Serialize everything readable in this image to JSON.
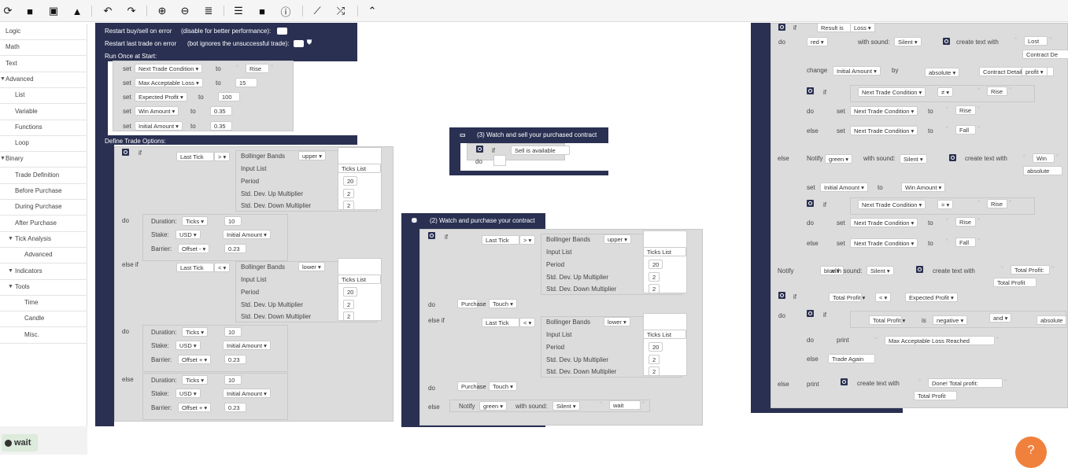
{
  "toolbar": {
    "icons": [
      "refresh-icon",
      "folder-icon",
      "save-icon",
      "drive-icon",
      "undo-icon",
      "redo-icon",
      "zoom-in-icon",
      "zoom-out-icon",
      "sort-icon",
      "list-icon",
      "stop-icon",
      "info-icon",
      "chart-icon",
      "shuffle-icon",
      "collapse-icon"
    ],
    "glyphs": [
      "⟳",
      "■",
      "▣",
      "▲",
      "↶",
      "↷",
      "⊕",
      "⊖",
      "≣",
      "☰",
      "■",
      "ⓘ",
      "⟋",
      "⤮",
      "⌃"
    ]
  },
  "sidebar": {
    "items": [
      {
        "label": "Logic",
        "depth": 0,
        "arrow": false
      },
      {
        "label": "Math",
        "depth": 0,
        "arrow": false
      },
      {
        "label": "Text",
        "depth": 0,
        "arrow": false
      },
      {
        "label": "Advanced",
        "depth": 0,
        "arrow": true
      },
      {
        "label": "List",
        "depth": 1,
        "arrow": false
      },
      {
        "label": "Variable",
        "depth": 1,
        "arrow": false
      },
      {
        "label": "Functions",
        "depth": 1,
        "arrow": false
      },
      {
        "label": "Loop",
        "depth": 1,
        "arrow": false
      },
      {
        "label": "Binary",
        "depth": 0,
        "arrow": true
      },
      {
        "label": "Trade Definition",
        "depth": 1,
        "arrow": false
      },
      {
        "label": "Before Purchase",
        "depth": 1,
        "arrow": false
      },
      {
        "label": "During Purchase",
        "depth": 1,
        "arrow": false
      },
      {
        "label": "After Purchase",
        "depth": 1,
        "arrow": false
      },
      {
        "label": "Tick Analysis",
        "depth": 1,
        "arrow": true
      },
      {
        "label": "Advanced",
        "depth": 2,
        "arrow": false
      },
      {
        "label": "Indicators",
        "depth": 1,
        "arrow": true
      },
      {
        "label": "Tools",
        "depth": 1,
        "arrow": true
      },
      {
        "label": "Time",
        "depth": 2,
        "arrow": false
      },
      {
        "label": "Candle",
        "depth": 2,
        "arrow": false
      },
      {
        "label": "Misc.",
        "depth": 2,
        "arrow": false
      }
    ]
  },
  "wait_button": "wait",
  "help_glyph": "?",
  "labels": {
    "set": "set",
    "to": "to",
    "if": "if",
    "do": "do",
    "else": "else",
    "else_if": "else if",
    "duration": "Duration:",
    "stake": "Stake:",
    "barrier": "Barrier:",
    "bollinger": "Bollinger Bands",
    "input_list": "Input List",
    "period": "Period",
    "std_up": "Std. Dev. Up Multiplier",
    "std_down": "Std. Dev. Down Multiplier",
    "ticks_list": "Ticks List",
    "last_tick": "Last Tick",
    "purchase": "Purchase",
    "touch": "Touch ▾",
    "notify": "Notify",
    "with_sound": "with sound:",
    "silent": "Silent ▾",
    "create_text": "create text with",
    "upper": "upper ▾",
    "lower": "lower ▾",
    "gt": ">  ▾",
    "lt": "<  ▾",
    "ticks": "Ticks ▾",
    "usd": "USD ▾",
    "initial_amount": "Initial Amount ▾",
    "offset_minus": "Offset - ▾",
    "offset_plus": "Offset + ▾",
    "v20": "20",
    "v2": "2",
    "v10": "10",
    "v023": "0.23",
    "print": "print",
    "change": "change",
    "by": "by",
    "absolute": "absolute ▾",
    "result_is": "Result is",
    "loss": "Loss ▾"
  },
  "block1": {
    "restart_err": "Restart buy/sell on error",
    "restart_err_note": "(disable for better performance):",
    "restart_last": "Restart last trade on error",
    "restart_last_note": "(bot ignores the unsuccessful trade):",
    "run_once": "Run Once at Start:",
    "define_trade": "Define Trade Options:",
    "vars": [
      {
        "name": "Next Trade Condition ▾",
        "value": "Rise",
        "text": true
      },
      {
        "name": "Max Acceptable Loss ▾",
        "value": "15",
        "text": false
      },
      {
        "name": "Expected Profit ▾",
        "value": "100",
        "text": false
      },
      {
        "name": "Win Amount ▾",
        "value": "0.35",
        "text": false
      },
      {
        "name": "Initial Amount ▾",
        "value": "0.35",
        "text": false
      }
    ]
  },
  "block3": {
    "title": "(3) Watch and sell your purchased contract",
    "cond": "Sell is available"
  },
  "block2": {
    "title": "(2) Watch and purchase your contract",
    "notify_color": "green ▾",
    "notify_text": "wait"
  },
  "block4": {
    "notify1_color": "red ▾",
    "lost": "Lost",
    "contract_de": "Contract De",
    "contract_detail": "Contract Detail:",
    "profit": "profit ▾",
    "next_cond": "Next Trade Condition ▾",
    "neq": "≠ ▾",
    "eq": "= ▾",
    "rise": "Rise",
    "fall": "Fall",
    "notify2_color": "green ▾",
    "win": "Win",
    "win_amount": "Win Amount ▾",
    "absolute_plain": "absolute",
    "notify3_color": "blue ▾",
    "total_profit_txt": "Total Profit:",
    "total_profit": "Total Profit",
    "total_profit_var": "Total Profit ▾",
    "lt": "< ▾",
    "expected_profit": "Expected Profit ▾",
    "is": "is",
    "negative": "negative ▾",
    "and": "and ▾",
    "absolu": "absolute",
    "max_loss": "Max Acceptable Loss Reached",
    "trade_again": "Trade Again",
    "done": "Done! Total profit:"
  }
}
